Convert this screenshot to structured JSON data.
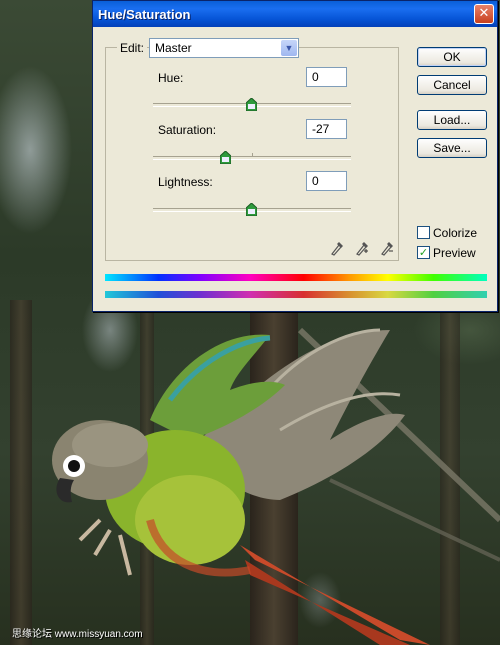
{
  "dialog": {
    "title": "Hue/Saturation",
    "close_glyph": "✕",
    "edit_label": "Edit:",
    "edit_value": "Master",
    "hue_label": "Hue:",
    "hue_value": "0",
    "saturation_label": "Saturation:",
    "saturation_value": "-27",
    "lightness_label": "Lightness:",
    "lightness_value": "0",
    "ok_label": "OK",
    "cancel_label": "Cancel",
    "load_label": "Load...",
    "save_label": "Save...",
    "colorize_label": "Colorize",
    "colorize_checked": false,
    "preview_label": "Preview",
    "preview_checked": true,
    "eyedropper_icons": [
      "eyedropper-icon",
      "eyedropper-plus-icon",
      "eyedropper-minus-icon"
    ]
  },
  "watermark": {
    "text": "思缘论坛 www.missyuan.com"
  },
  "colors": {
    "titlebar": "#0a5fd8",
    "dialog_bg": "#ece9d8",
    "thumb": "#2e9a3c"
  }
}
